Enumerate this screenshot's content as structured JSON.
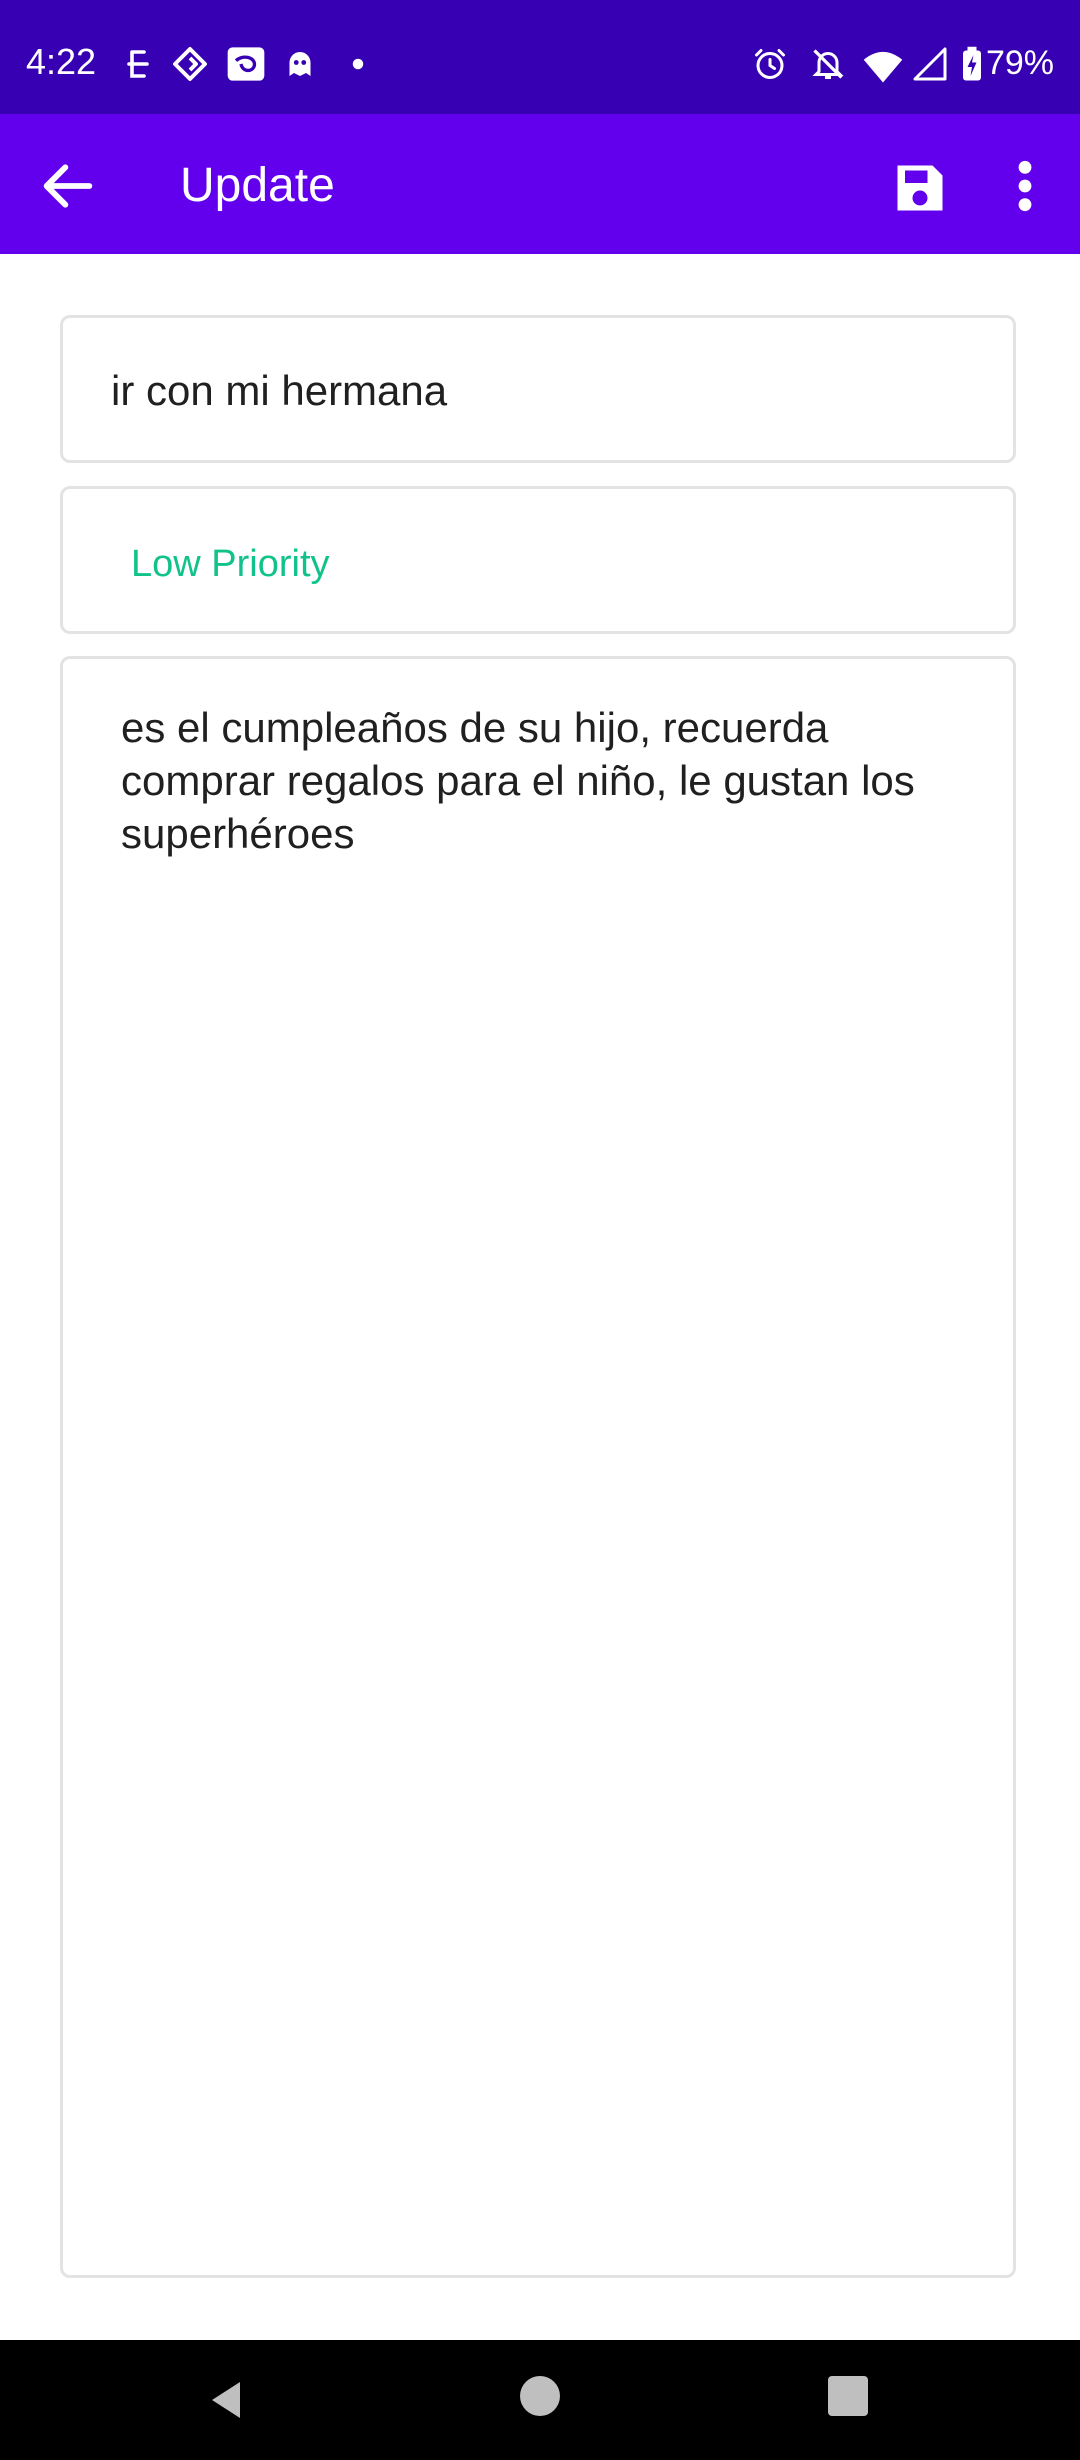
{
  "status_bar": {
    "time": "4:22",
    "battery_percent": "79%",
    "icons_left": [
      "threads-icon",
      "diamond-app-icon",
      "disney-plus-icon",
      "ghost-app-icon",
      "notification-dot-icon"
    ],
    "icons_right": [
      "alarm-icon",
      "notifications-off-icon",
      "wifi-icon",
      "cell-signal-icon",
      "battery-charging-icon"
    ]
  },
  "app_bar": {
    "title": "Update",
    "back_icon": "arrow-back-icon",
    "save_icon": "save-icon",
    "menu_icon": "more-vert-icon",
    "background": "#6200ee"
  },
  "form": {
    "title_value": "ir con mi hermana",
    "priority_value": "Low Priority",
    "priority_color": "#11c38a",
    "description_value": "es el cumpleaños de su hijo, recuerda comprar regalos para el niño, le gustan los superhéroes"
  },
  "nav_bar": {
    "icons": [
      "nav-back-icon",
      "nav-home-icon",
      "nav-recents-icon"
    ]
  }
}
